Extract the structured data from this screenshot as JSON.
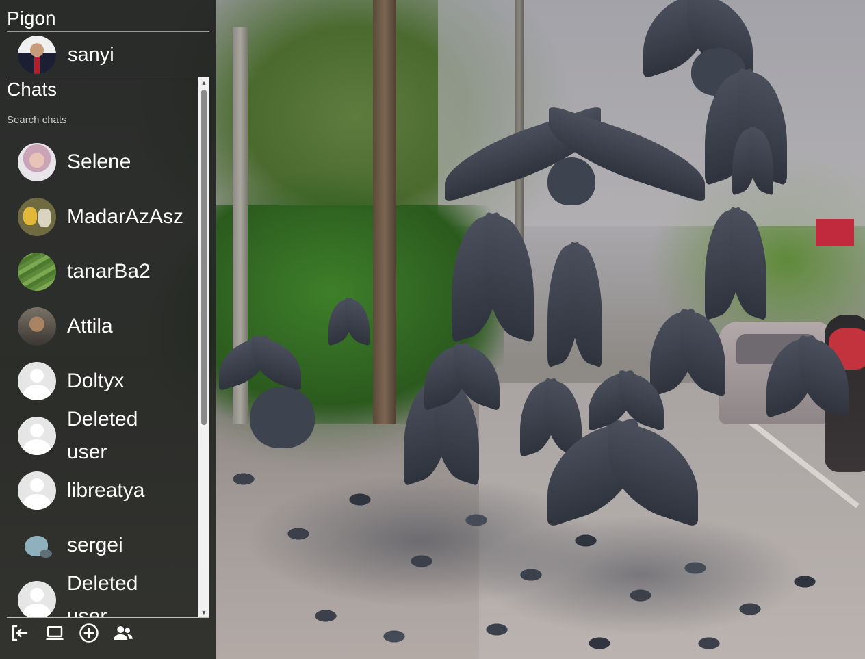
{
  "app": {
    "title": "Pigon"
  },
  "current_user": {
    "name": "sanyi",
    "avatar": "profile-photo"
  },
  "chats": {
    "heading": "Chats",
    "search_label": "Search chats",
    "items": [
      {
        "name": "Selene",
        "avatar": "photo"
      },
      {
        "name": "MadarAzAsz",
        "avatar": "cartoon"
      },
      {
        "name": "tanarBa2",
        "avatar": "landscape"
      },
      {
        "name": "Attila",
        "avatar": "photo"
      },
      {
        "name": "Doltyx",
        "avatar": "default-user"
      },
      {
        "name": "Deleted user",
        "avatar": "default-user"
      },
      {
        "name": "libreatya",
        "avatar": "default-user"
      },
      {
        "name": "sergei",
        "avatar": "pigeon"
      },
      {
        "name": "Deleted user",
        "avatar": "default-user"
      }
    ]
  },
  "toolbar": {
    "icons": [
      "logout-icon",
      "laptop-icon",
      "add-circle-icon",
      "group-icon"
    ]
  },
  "colors": {
    "sidebar_bg": "#202220",
    "text": "#ffffff",
    "muted_text": "#c8c8c8",
    "divider": "#bdbdbd"
  }
}
